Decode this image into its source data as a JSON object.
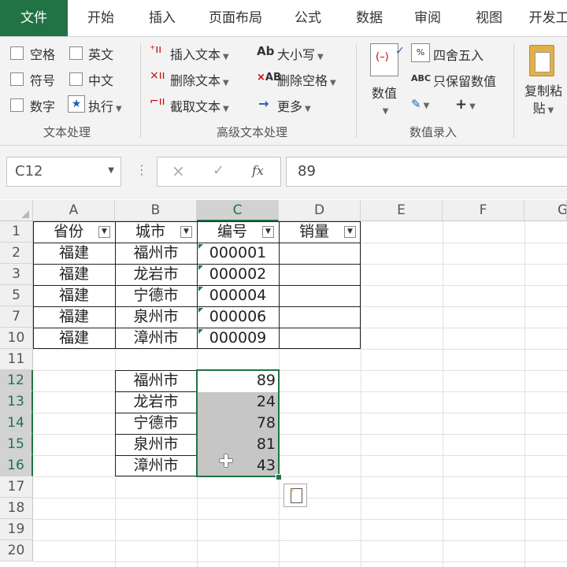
{
  "tabs": [
    "文件",
    "开始",
    "插入",
    "页面布局",
    "公式",
    "数据",
    "审阅",
    "视图",
    "开发工"
  ],
  "ribbon": {
    "text_group": {
      "items": [
        "空格",
        "英文",
        "符号",
        "中文",
        "数字",
        "执行"
      ],
      "label": "文本处理"
    },
    "advanced_group": {
      "insert_text": "插入文本",
      "delete_text": "删除文本",
      "extract_text": "截取文本",
      "case": "大小写",
      "delete_space": "删除空格",
      "more": "更多",
      "label": "高级文本处理",
      "ab_glyph": "Ab",
      "ab2_glyph": "AB"
    },
    "number_group": {
      "value": "数值",
      "round": "四舍五入",
      "keep_value": "只保留数值",
      "label": "数值录入",
      "abc_glyph": "ABC",
      "plus": "+"
    },
    "copy_group": {
      "copy_line1": "复制粘",
      "copy_line2": "贴"
    }
  },
  "formula_bar": {
    "name_box": "C12",
    "cancel": "×",
    "enter": "✓",
    "fx": "fx",
    "value": "89",
    "dots": "⋮"
  },
  "columns": [
    "A",
    "B",
    "C",
    "D",
    "E",
    "F",
    "G"
  ],
  "rows": [
    "1",
    "2",
    "3",
    "5",
    "7",
    "10",
    "11",
    "12",
    "13",
    "14",
    "15",
    "16",
    "17",
    "18",
    "19",
    "20"
  ],
  "header_row": [
    "省份",
    "城市",
    "编号",
    "销量"
  ],
  "data_rows": [
    [
      "福建",
      "福州市",
      "000001"
    ],
    [
      "福建",
      "龙岩市",
      "000002"
    ],
    [
      "福建",
      "宁德市",
      "000004"
    ],
    [
      "福建",
      "泉州市",
      "000006"
    ],
    [
      "福建",
      "漳州市",
      "000009"
    ]
  ],
  "lower_rows": [
    [
      "福州市",
      "89"
    ],
    [
      "龙岩市",
      "24"
    ],
    [
      "宁德市",
      "78"
    ],
    [
      "泉州市",
      "81"
    ],
    [
      "漳州市",
      "43"
    ]
  ]
}
